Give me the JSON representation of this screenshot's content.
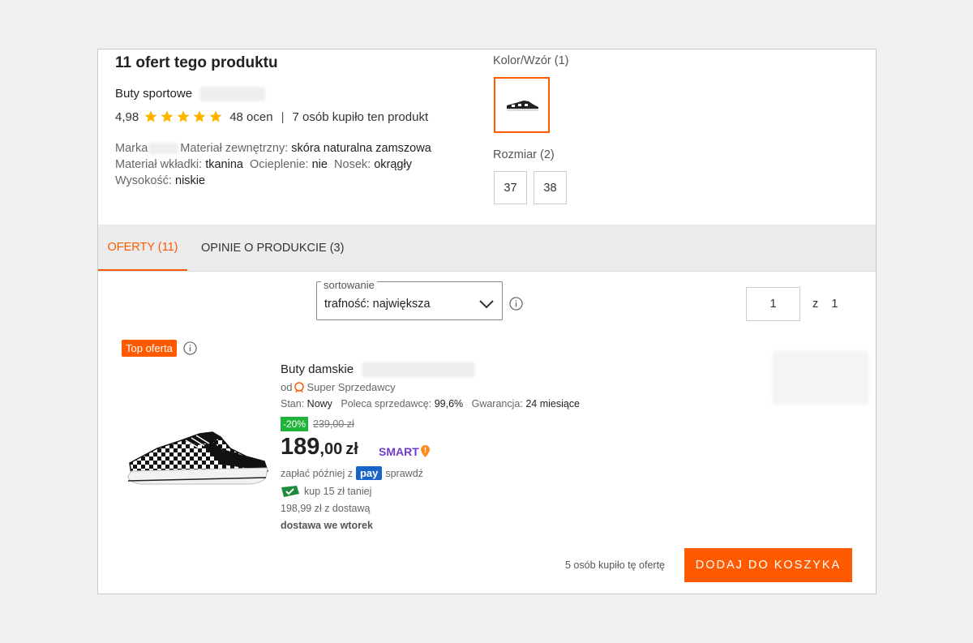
{
  "product": {
    "offers_title": "11 ofert tego produktu",
    "name": "Buty sportowe",
    "rating": "4,98",
    "stars_count": 5,
    "ratings_count": "48 ocen",
    "sep": "|",
    "buyers": "7 osób kupiło ten produkt",
    "specs": {
      "marka_label": "Marka",
      "material_label": "Materiał zewnętrzny:",
      "material_value": "skóra naturalna zamszowa",
      "wkladka_label": "Materiał wkładki:",
      "wkladka_value": "tkanina",
      "ocieplenie_label": "Ocieplenie:",
      "ocieplenie_value": "nie",
      "nosek_label": "Nosek:",
      "nosek_value": "okrągły",
      "wysokosc_label": "Wysokość:",
      "wysokosc_value": "niskie"
    },
    "color_label": "Kolor/Wzór (1)",
    "size_label": "Rozmiar (2)",
    "sizes": [
      "37",
      "38"
    ]
  },
  "tabs": [
    {
      "label": "OFERTY (11)"
    },
    {
      "label": "OPINIE O PRODUKCIE (3)"
    }
  ],
  "sort": {
    "legend": "sortowanie",
    "value": "trafność: największa"
  },
  "pagination": {
    "current": "1",
    "of": "z",
    "total": "1"
  },
  "offer": {
    "badge": "Top oferta",
    "title": "Buty damskie",
    "seller_prefix": "od",
    "seller": "Super Sprzedawcy",
    "stan_label": "Stan:",
    "stan_value": "Nowy",
    "poleca_label": "Poleca sprzedawcę:",
    "poleca_value": "99,6%",
    "gwarancja_label": "Gwarancja:",
    "gwarancja_value": "24 miesiące",
    "discount": "-20%",
    "old_price": "239,00 zł",
    "price_main": "189",
    "price_cents": ",00",
    "currency": "zł",
    "smart": "SMART",
    "pay_prefix": "zapłać później z",
    "pay_brand": "pay",
    "pay_suffix": "sprawdź",
    "coupon": "kup 15 zł taniej",
    "delivery_price": "198,99 zł z dostawą",
    "delivery_day": "dostawa we wtorek",
    "buyers": "5 osób kupiło tę ofertę",
    "cart_button": "DODAJ DO KOSZYKA"
  },
  "colors": {
    "accent": "#ff5a00",
    "star": "#ffb500",
    "discount": "#1fb33a",
    "smart": "#6e3ccf",
    "pay": "#1a63c8"
  }
}
